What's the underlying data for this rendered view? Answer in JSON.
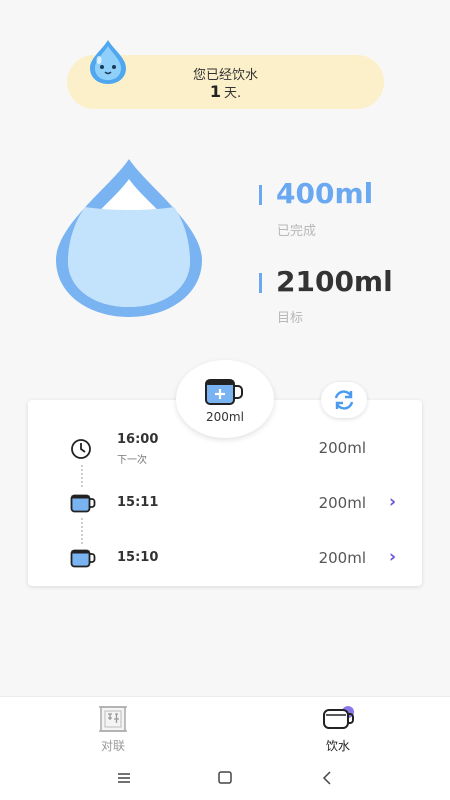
{
  "banner": {
    "line1": "您已经饮水",
    "days": "1",
    "days_suffix": "天."
  },
  "stats": {
    "completed_value": "400ml",
    "completed_label": "已完成",
    "goal_value": "2100ml",
    "goal_label": "目标"
  },
  "add_cup": {
    "amount": "200ml"
  },
  "records": [
    {
      "time": "16:00",
      "sub": "下一次",
      "amount": "200ml",
      "kind": "clock-icon"
    },
    {
      "time": "15:11",
      "amount": "200ml",
      "kind": "cup-icon"
    },
    {
      "time": "15:10",
      "amount": "200ml",
      "kind": "cup-icon"
    }
  ],
  "tabs": [
    {
      "label": "对联",
      "icon": "couplet-icon"
    },
    {
      "label": "饮水",
      "icon": "water-cup-icon"
    }
  ],
  "colors": {
    "accent_blue": "#6aa9f2",
    "banner_bg": "#fbf0c9",
    "chevron_purple": "#6b4fe0"
  }
}
